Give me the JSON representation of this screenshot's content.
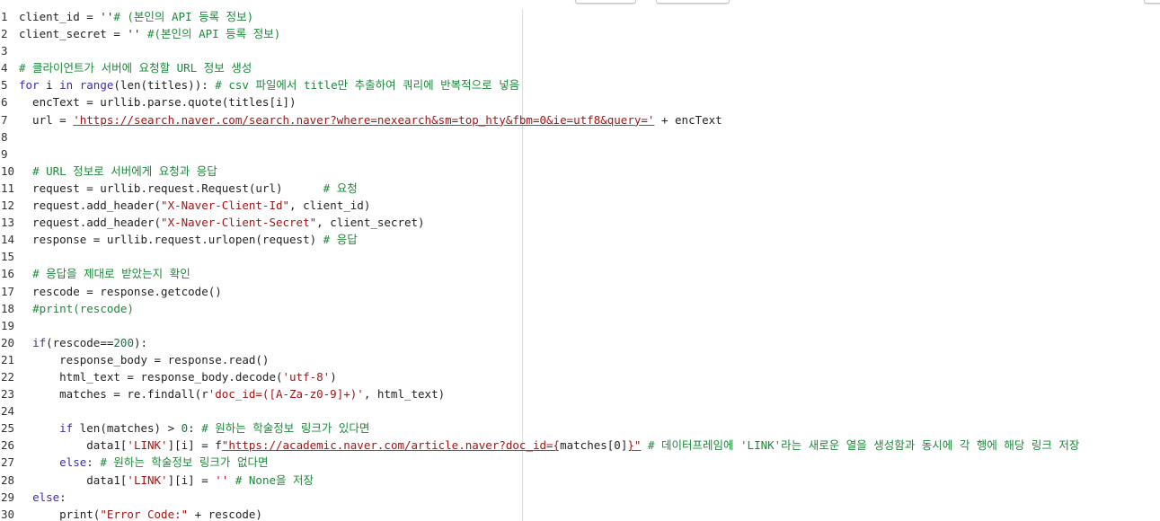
{
  "editor": {
    "lines": [
      {
        "n": "1",
        "segs": [
          {
            "t": "client_id = ''"
          },
          {
            "t": "# (본인의 API 등록 정보)",
            "c": "cmt"
          }
        ]
      },
      {
        "n": "2",
        "segs": [
          {
            "t": "client_secret = '' "
          },
          {
            "t": "#(본인의 API 등록 정보)",
            "c": "cmt"
          }
        ]
      },
      {
        "n": "3",
        "segs": []
      },
      {
        "n": "4",
        "segs": [
          {
            "t": "# 클라이언트가 서버에 요청할 URL 정보 생성",
            "c": "cmt"
          }
        ]
      },
      {
        "n": "5",
        "segs": [
          {
            "t": "for",
            "c": "kw"
          },
          {
            "t": " i "
          },
          {
            "t": "in",
            "c": "kw"
          },
          {
            "t": " "
          },
          {
            "t": "range",
            "c": "fn"
          },
          {
            "t": "(len(titles)): "
          },
          {
            "t": "# csv 파일에서 title만 추출하여 쿼리에 반복적으로 넣음",
            "c": "cmt"
          }
        ]
      },
      {
        "n": "6",
        "segs": [
          {
            "t": "  encText = urllib.parse.quote(titles[i])"
          }
        ]
      },
      {
        "n": "7",
        "segs": [
          {
            "t": "  url = "
          },
          {
            "t": "'https://search.naver.com/search.naver?where=nexearch&sm=top_hty&fbm=0&ie=utf8&query='",
            "c": "url"
          },
          {
            "t": " + encText"
          }
        ]
      },
      {
        "n": "8",
        "segs": []
      },
      {
        "n": "9",
        "segs": []
      },
      {
        "n": "10",
        "segs": [
          {
            "t": "  "
          },
          {
            "t": "# URL 정보로 서버에게 요청과 응답",
            "c": "cmt"
          }
        ]
      },
      {
        "n": "11",
        "segs": [
          {
            "t": "  request = urllib.request.Request(url)      "
          },
          {
            "t": "# 요청",
            "c": "cmt"
          }
        ]
      },
      {
        "n": "12",
        "segs": [
          {
            "t": "  request.add_header("
          },
          {
            "t": "\"X-Naver-Client-Id\"",
            "c": "str"
          },
          {
            "t": ", client_id)"
          }
        ]
      },
      {
        "n": "13",
        "segs": [
          {
            "t": "  request.add_header("
          },
          {
            "t": "\"X-Naver-Client-Secret\"",
            "c": "str"
          },
          {
            "t": ", client_secret)"
          }
        ]
      },
      {
        "n": "14",
        "segs": [
          {
            "t": "  response = urllib.request.urlopen(request) "
          },
          {
            "t": "# 응답",
            "c": "cmt"
          }
        ]
      },
      {
        "n": "15",
        "segs": []
      },
      {
        "n": "16",
        "segs": [
          {
            "t": "  "
          },
          {
            "t": "# 응답을 제대로 받았는지 확인",
            "c": "cmt"
          }
        ]
      },
      {
        "n": "17",
        "segs": [
          {
            "t": "  rescode = response.getcode()"
          }
        ]
      },
      {
        "n": "18",
        "segs": [
          {
            "t": "  "
          },
          {
            "t": "#print(rescode)",
            "c": "cmt"
          }
        ]
      },
      {
        "n": "19",
        "segs": []
      },
      {
        "n": "20",
        "segs": [
          {
            "t": "  "
          },
          {
            "t": "if",
            "c": "kw"
          },
          {
            "t": "(rescode=="
          },
          {
            "t": "200",
            "c": "num"
          },
          {
            "t": "):"
          }
        ]
      },
      {
        "n": "21",
        "segs": [
          {
            "t": "      response_body = response.read()"
          }
        ]
      },
      {
        "n": "22",
        "segs": [
          {
            "t": "      html_text = response_body.decode("
          },
          {
            "t": "'utf-8'",
            "c": "str"
          },
          {
            "t": ")"
          }
        ]
      },
      {
        "n": "23",
        "segs": [
          {
            "t": "      matches = re.findall(r"
          },
          {
            "t": "'doc_id=([A-Za-z0-9]+)'",
            "c": "str"
          },
          {
            "t": ", html_text)"
          }
        ]
      },
      {
        "n": "24",
        "segs": []
      },
      {
        "n": "25",
        "segs": [
          {
            "t": "      "
          },
          {
            "t": "if",
            "c": "kw"
          },
          {
            "t": " len(matches) > "
          },
          {
            "t": "0",
            "c": "num"
          },
          {
            "t": ": "
          },
          {
            "t": "# 원하는 학술정보 링크가 있다면",
            "c": "cmt"
          }
        ]
      },
      {
        "n": "26",
        "segs": [
          {
            "t": "          data1["
          },
          {
            "t": "'LINK'",
            "c": "str"
          },
          {
            "t": "][i] = f"
          },
          {
            "t": "\"https://academic.naver.com/article.naver?doc_id={",
            "c": "url"
          },
          {
            "t": "matches[0]"
          },
          {
            "t": "}\"",
            "c": "url"
          },
          {
            "t": " "
          },
          {
            "t": "# 데이터프레임에 'LINK'라는 새로운 열을 생성함과 동시에 각 행에 해당 링크 저장",
            "c": "cmt"
          }
        ]
      },
      {
        "n": "27",
        "segs": [
          {
            "t": "      "
          },
          {
            "t": "else",
            "c": "kw"
          },
          {
            "t": ": "
          },
          {
            "t": "# 원하는 학술정보 링크가 없다면",
            "c": "cmt"
          }
        ]
      },
      {
        "n": "28",
        "segs": [
          {
            "t": "          data1["
          },
          {
            "t": "'LINK'",
            "c": "str"
          },
          {
            "t": "][i] = "
          },
          {
            "t": "''",
            "c": "str"
          },
          {
            "t": " "
          },
          {
            "t": "# None을 저장",
            "c": "cmt"
          }
        ]
      },
      {
        "n": "29",
        "segs": [
          {
            "t": "  "
          },
          {
            "t": "else",
            "c": "kw"
          },
          {
            "t": ":"
          }
        ]
      },
      {
        "n": "30",
        "segs": [
          {
            "t": "      print("
          },
          {
            "t": "\"Error Code:\"",
            "c": "str"
          },
          {
            "t": " + rescode)"
          }
        ]
      }
    ]
  },
  "colors": {
    "keyword": "#3a2fa8",
    "string": "#a31515",
    "number": "#0b7a3e",
    "comment": "#1c8a3a"
  }
}
